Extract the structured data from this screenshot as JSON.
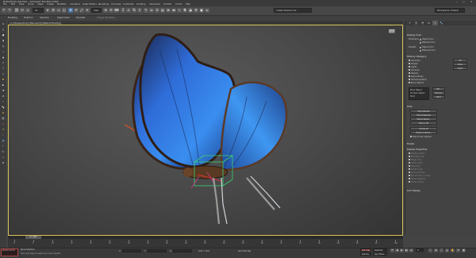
{
  "window": {
    "title": "Butterfly01.3ds Max - Autodesk 3ds Max 2018",
    "controls": [
      "—",
      "□",
      "✕"
    ]
  },
  "menu": [
    "File",
    "Edit",
    "Tools",
    "Group",
    "Views",
    "Create",
    "Modifiers",
    "Animation",
    "Graph Editors",
    "Rendering",
    "Civil View",
    "Customize",
    "Scripting",
    "Interactive",
    "Content",
    "Arnold",
    "Help"
  ],
  "toolbar": {
    "filter": "All",
    "view_dropdown": "View",
    "selection_set": "Create Selection Se",
    "workspace": "Workspaces: Default"
  },
  "ribbon": {
    "tabs": [
      "Modeling",
      "Freeform",
      "Selection",
      "Object Paint",
      "Populate"
    ],
    "sub": "Polygon Modeling"
  },
  "viewport": {
    "label": "[+] [Perspective] [Standard] [Default Shading]"
  },
  "right_panel": {
    "tabs": [
      "+",
      "◳",
      "◔",
      "▭",
      "⌖",
      "🔧"
    ],
    "display_color": {
      "title": "Display Color",
      "wireframe_label": "Wireframe:",
      "shaded_label": "Shaded:",
      "object_color": "Object Color",
      "material_color": "Material Color"
    },
    "hide_by_category": {
      "title": "Hide by Category",
      "items": [
        "Geometry",
        "Shapes",
        "Lights",
        "Cameras",
        "Helpers",
        "Space Warps",
        "Particle Systems",
        "Bone Objects"
      ],
      "buttons": [
        "All",
        "None",
        "Invert"
      ],
      "list": [
        "Bone Object",
        "IK Chain Object",
        "Point"
      ],
      "add": "Add...",
      "remove": "Remove",
      "none": "None"
    },
    "hide": {
      "title": "Hide",
      "buttons": [
        "Hide Selected",
        "Hide Unselected",
        "Hide by Name...",
        "Hide by Hit",
        "Unhide All",
        "Unhide by Name..."
      ],
      "checkbox": "Hide Frozen Objects"
    },
    "freeze": {
      "title": "Freeze"
    },
    "display_properties": {
      "title": "Display Properties",
      "items": [
        "Display as Box",
        "Backface Cull",
        "Edges Only",
        "Vertex Ticks",
        "Trajectory",
        "See-Through",
        "Ignore Extents",
        "Show Frozen in Gray",
        "Never Degrade",
        "Vertex Colors"
      ]
    },
    "link_display": {
      "title": "Link Display"
    }
  },
  "timeline": {
    "slider": "0 / 100",
    "ticks": [
      "0",
      "5",
      "10",
      "15",
      "20",
      "25",
      "30",
      "35",
      "40",
      "45",
      "50",
      "55",
      "60",
      "65",
      "70",
      "75",
      "80",
      "85",
      "90",
      "95",
      "100"
    ]
  },
  "status": {
    "script_label": "MAXScript Mi",
    "selection": "None Selected",
    "prompt": "Click and drag to select and move objects",
    "x_label": "X:",
    "y_label": "Y:",
    "z_label": "Z:",
    "grid": "Grid = 10.0",
    "add_time_tag": "Add Time Tag",
    "auto_key": "Auto Key",
    "selected": "Selected",
    "set_key": "Set Key",
    "key_filters": "Key Filters...",
    "frame": "0"
  },
  "colors": {
    "accent_yellow": "#d8c25a",
    "wing_blue": "#2f7ee0",
    "selection_red": "#b04a4a"
  }
}
